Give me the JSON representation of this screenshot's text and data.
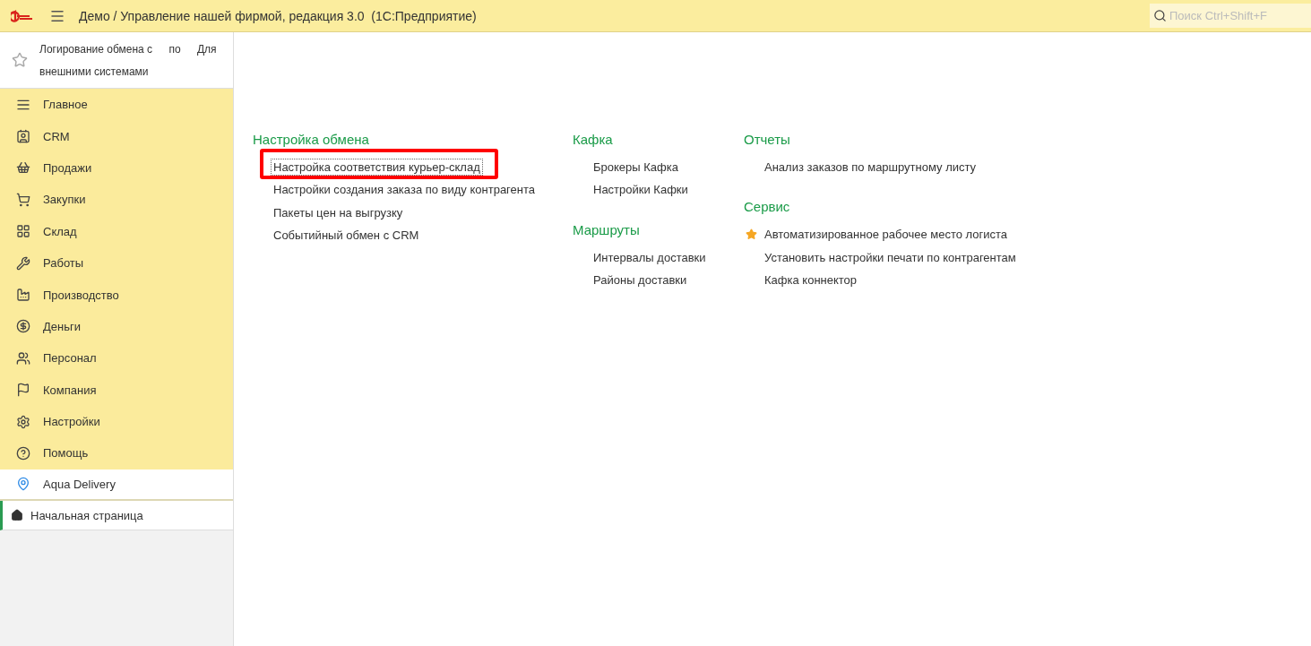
{
  "window": {
    "title": "Демо / Управление нашей фирмой, редакция 3.0  (1С:Предприятие)"
  },
  "search": {
    "placeholder": "Поиск Ctrl+Shift+F"
  },
  "favorites_panel": {
    "favorite": false,
    "texts": [
      "Логирование обмена с",
      "по",
      "Для",
      "внешними системами"
    ]
  },
  "sidebar": {
    "items": [
      {
        "label": "Главное",
        "selected": false
      },
      {
        "label": "CRM",
        "selected": false
      },
      {
        "label": "Продажи",
        "selected": false
      },
      {
        "label": "Закупки",
        "selected": false
      },
      {
        "label": "Склад",
        "selected": false
      },
      {
        "label": "Работы",
        "selected": false
      },
      {
        "label": "Производство",
        "selected": false
      },
      {
        "label": "Деньги",
        "selected": false
      },
      {
        "label": "Персонал",
        "selected": false
      },
      {
        "label": "Компания",
        "selected": false
      },
      {
        "label": "Настройки",
        "selected": false
      },
      {
        "label": "Помощь",
        "selected": false
      },
      {
        "label": "Aqua Delivery",
        "selected": true
      }
    ]
  },
  "open_pages": [
    {
      "label": "Начальная страница",
      "selected": true
    }
  ],
  "columns": [
    {
      "groups": [
        {
          "title": "Настройка обмена",
          "links": [
            {
              "label": "Настройка соответствия курьер-склад",
              "favorite": false,
              "focused": true,
              "highlighted": true
            },
            {
              "label": "Настройки создания заказа по виду контрагента",
              "favorite": false,
              "focused": false,
              "highlighted": false
            },
            {
              "label": "Пакеты цен на выгрузку",
              "favorite": false,
              "focused": false,
              "highlighted": false
            },
            {
              "label": "Событийный обмен с CRM",
              "favorite": false,
              "focused": false,
              "highlighted": false
            }
          ]
        }
      ]
    },
    {
      "groups": [
        {
          "title": "Кафка",
          "links": [
            {
              "label": "Брокеры Кафка",
              "favorite": false,
              "focused": false,
              "highlighted": false
            },
            {
              "label": "Настройки Кафки",
              "favorite": false,
              "focused": false,
              "highlighted": false
            }
          ]
        },
        {
          "title": "Маршруты",
          "links": [
            {
              "label": "Интервалы доставки",
              "favorite": false,
              "focused": false,
              "highlighted": false
            },
            {
              "label": "Районы доставки",
              "favorite": false,
              "focused": false,
              "highlighted": false
            }
          ]
        }
      ]
    },
    {
      "groups": [
        {
          "title": "Отчеты",
          "links": [
            {
              "label": "Анализ заказов по маршрутному листу",
              "favorite": false,
              "focused": false,
              "highlighted": false
            }
          ]
        },
        {
          "title": "Сервис",
          "links": [
            {
              "label": "Автоматизированное рабочее место логиста",
              "favorite": true,
              "focused": false,
              "highlighted": false
            },
            {
              "label": "Установить настройки печати по контрагентам",
              "favorite": false,
              "focused": false,
              "highlighted": false
            },
            {
              "label": "Кафка коннектор",
              "favorite": false,
              "focused": false,
              "highlighted": false
            }
          ]
        }
      ]
    }
  ]
}
